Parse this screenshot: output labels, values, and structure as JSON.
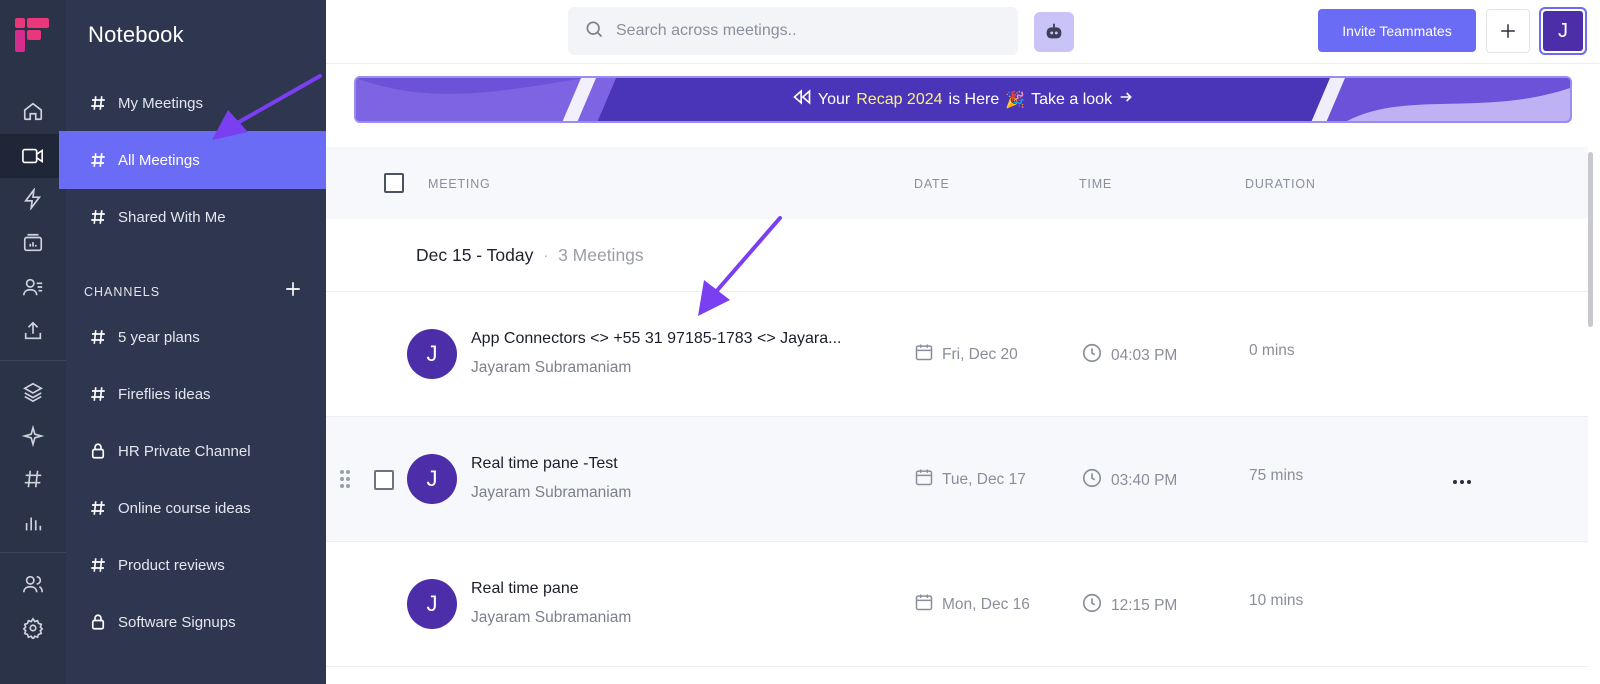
{
  "app": {
    "title": "Notebook"
  },
  "sidebar": {
    "items": [
      {
        "label": "My Meetings",
        "icon": "hash-icon"
      },
      {
        "label": "All Meetings",
        "icon": "hash-icon",
        "active": true
      },
      {
        "label": "Shared With Me",
        "icon": "hash-icon"
      }
    ],
    "channels_label": "CHANNELS",
    "channels": [
      {
        "label": "5 year plans",
        "icon": "hash-icon"
      },
      {
        "label": "Fireflies ideas",
        "icon": "hash-icon"
      },
      {
        "label": "HR Private Channel",
        "icon": "lock-icon"
      },
      {
        "label": "Online course ideas",
        "icon": "hash-icon"
      },
      {
        "label": "Product reviews",
        "icon": "hash-icon"
      },
      {
        "label": "Software Signups",
        "icon": "lock-icon"
      }
    ]
  },
  "rail": {
    "icons": [
      "home-icon",
      "video-icon",
      "bolt-icon",
      "analytics-icon",
      "contacts-icon",
      "upload-icon",
      "layers-icon",
      "sparkle-icon",
      "hash-icon",
      "bar-chart-icon",
      "team-icon",
      "settings-icon"
    ]
  },
  "topbar": {
    "search_placeholder": "Search across meetings..",
    "invite_label": "Invite Teammates",
    "user_initial": "J"
  },
  "banner": {
    "prefix": "Your",
    "highlight": "Recap 2024",
    "suffix": "is Here",
    "emoji": "🎉",
    "cta": "Take a look"
  },
  "table": {
    "headers": {
      "meeting": "MEETING",
      "date": "DATE",
      "time": "TIME",
      "duration": "DURATION"
    },
    "group": {
      "title": "Dec 15 - Today",
      "separator": "·",
      "count": "3 Meetings"
    },
    "rows": [
      {
        "initial": "J",
        "title": "App Connectors <> +55 31 97185-1783 <> Jayara...",
        "owner": "Jayaram Subramaniam",
        "date": "Fri, Dec 20",
        "time": "04:03 PM",
        "duration": "0 mins"
      },
      {
        "initial": "J",
        "title": "Real time pane -Test",
        "owner": "Jayaram Subramaniam",
        "date": "Tue, Dec 17",
        "time": "03:40 PM",
        "duration": "75 mins"
      },
      {
        "initial": "J",
        "title": "Real time pane",
        "owner": "Jayaram Subramaniam",
        "date": "Mon, Dec 16",
        "time": "12:15 PM",
        "duration": "10 mins"
      }
    ]
  },
  "colors": {
    "accent": "#6a6cf5",
    "sidebar": "#2f3750",
    "rail": "#2b3348",
    "avatar": "#4b2ea8",
    "arrow": "#7b3ff2"
  }
}
